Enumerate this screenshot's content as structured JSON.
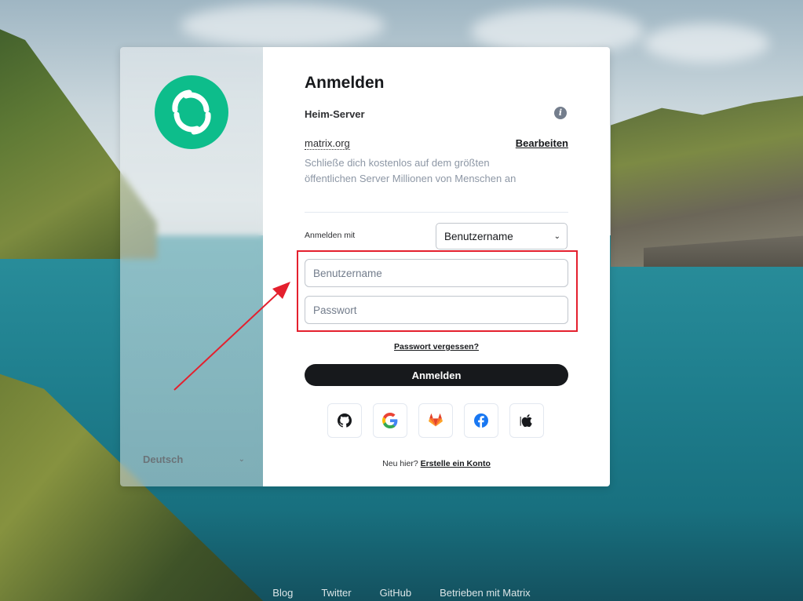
{
  "auth": {
    "title": "Anmelden",
    "homeserver_label": "Heim-Server",
    "homeserver_name": "matrix.org",
    "edit_label": "Bearbeiten",
    "homeserver_description": "Schließe dich kostenlos auf dem größten öffentlichen Server Millionen von Menschen an",
    "login_with_label": "Anmelden mit",
    "login_type_selected": "Benutzername",
    "username_placeholder": "Benutzername",
    "password_placeholder": "Passwort",
    "forgot_password": "Passwort vergessen?",
    "submit_label": "Anmelden",
    "sso_providers": [
      "github-icon",
      "google-icon",
      "gitlab-icon",
      "facebook-icon",
      "apple-icon"
    ],
    "new_here": "Neu hier?",
    "create_account": "Erstelle ein Konto"
  },
  "sidebar": {
    "language": "Deutsch"
  },
  "footer_links": [
    "Blog",
    "Twitter",
    "GitHub",
    "Betrieben mit Matrix"
  ],
  "colors": {
    "brand_green": "#0dbd8b",
    "primary_button": "#17191c",
    "annotation_red": "#e4202e"
  }
}
